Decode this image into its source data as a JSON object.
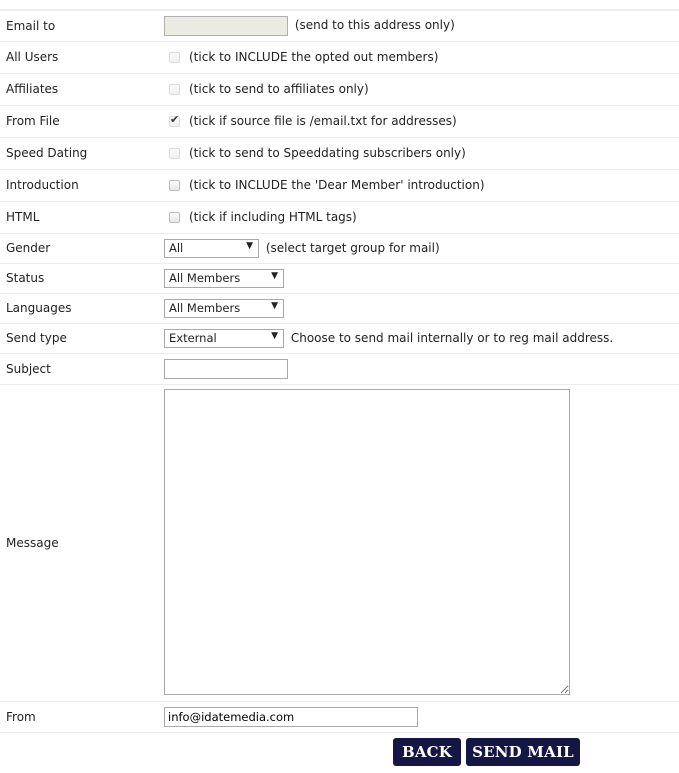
{
  "form": {
    "email_to": {
      "label": "Email to",
      "value": "",
      "note": "(send to this address only)",
      "disabled": true
    },
    "all_users": {
      "label": "All Users",
      "checked": false,
      "disabled": true,
      "note": "(tick to INCLUDE the opted out members)"
    },
    "affiliates": {
      "label": "Affiliates",
      "checked": false,
      "disabled": true,
      "note": "(tick to send to affiliates only)"
    },
    "from_file": {
      "label": "From File",
      "checked": true,
      "disabled": true,
      "note": "(tick if source file is /email.txt for addresses)"
    },
    "speed_dating": {
      "label": "Speed Dating",
      "checked": false,
      "disabled": true,
      "note": "(tick to send to Speeddating subscribers only)"
    },
    "introduction": {
      "label": "Introduction",
      "checked": false,
      "disabled": false,
      "note": "(tick to INCLUDE the 'Dear Member' introduction)"
    },
    "html": {
      "label": "HTML",
      "checked": false,
      "disabled": false,
      "note": "(tick if including HTML tags)"
    },
    "gender": {
      "label": "Gender",
      "selected": "All",
      "note": "(select target group for mail)"
    },
    "status": {
      "label": "Status",
      "selected": "All Members"
    },
    "languages": {
      "label": "Languages",
      "selected": "All Members"
    },
    "send_type": {
      "label": "Send type",
      "selected": "External",
      "note": "Choose to send mail internally or to reg mail address."
    },
    "subject": {
      "label": "Subject",
      "value": ""
    },
    "message": {
      "label": "Message",
      "value": ""
    },
    "from": {
      "label": "From",
      "value": "info@idatemedia.com"
    }
  },
  "buttons": {
    "back": "BACK",
    "send_mail": "SEND MAIL"
  },
  "colors": {
    "button_bg": "#141744",
    "button_text": "#ffffff"
  }
}
